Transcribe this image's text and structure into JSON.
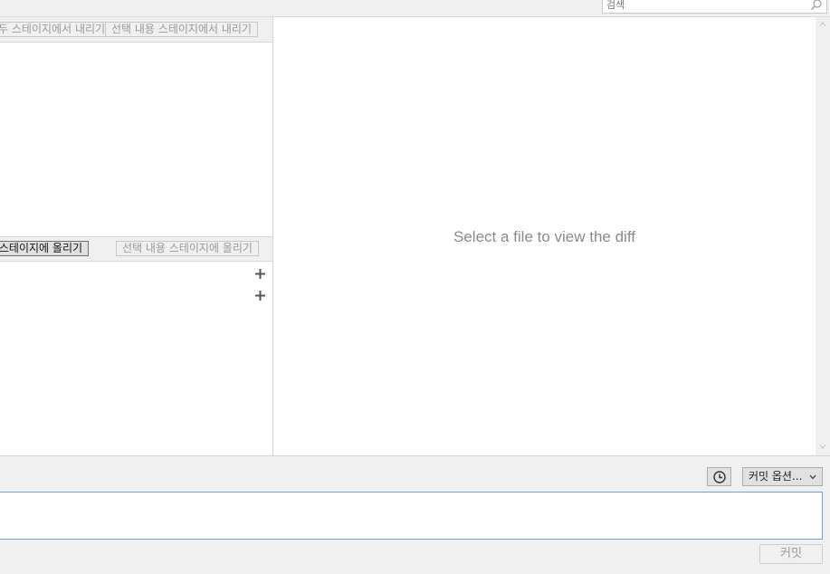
{
  "search": {
    "placeholder": "검색",
    "value": ""
  },
  "staged": {
    "unstage_all_label": "모두 스테이지에서 내리기",
    "unstage_selected_label": "선택 내용 스테이지에서 내리기"
  },
  "unstaged": {
    "stage_all_label": "모두 스테이지에 올리기",
    "stage_selected_label": "선택 내용 스테이지에 올리기",
    "rows": [
      {
        "stage_icon": "plus-icon"
      },
      {
        "stage_icon": "plus-icon"
      }
    ]
  },
  "diff": {
    "placeholder": "Select a file to view the diff"
  },
  "commit": {
    "history_icon": "clock-icon",
    "options_label": "커밋 옵션...",
    "message_value": "",
    "commit_label": "커밋"
  }
}
